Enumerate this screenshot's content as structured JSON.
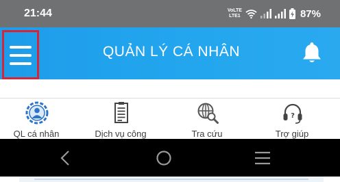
{
  "status_bar": {
    "time": "21:44",
    "volte_line1": "VoLTE",
    "volte_line2": "LTE1",
    "battery_percent": "87%"
  },
  "app_bar": {
    "title": "QUẢN LÝ CÁ NHÂN",
    "menu_icon": "hamburger-menu-icon",
    "notification_icon": "bell-icon",
    "highlight_color": "#d92433",
    "background_color": "#1e9cea"
  },
  "nav": {
    "items": [
      {
        "label": "QL cá nhân",
        "icon": "person-gear-icon"
      },
      {
        "label": "Dịch vụ công",
        "icon": "document-icon"
      },
      {
        "label": "Tra cứu",
        "icon": "globe-search-icon"
      },
      {
        "label": "Trợ giúp",
        "icon": "headset-icon"
      }
    ]
  },
  "system_nav": {
    "back_icon": "back-chevron-icon",
    "home_icon": "home-circle-icon",
    "recents_icon": "recents-lines-icon"
  }
}
